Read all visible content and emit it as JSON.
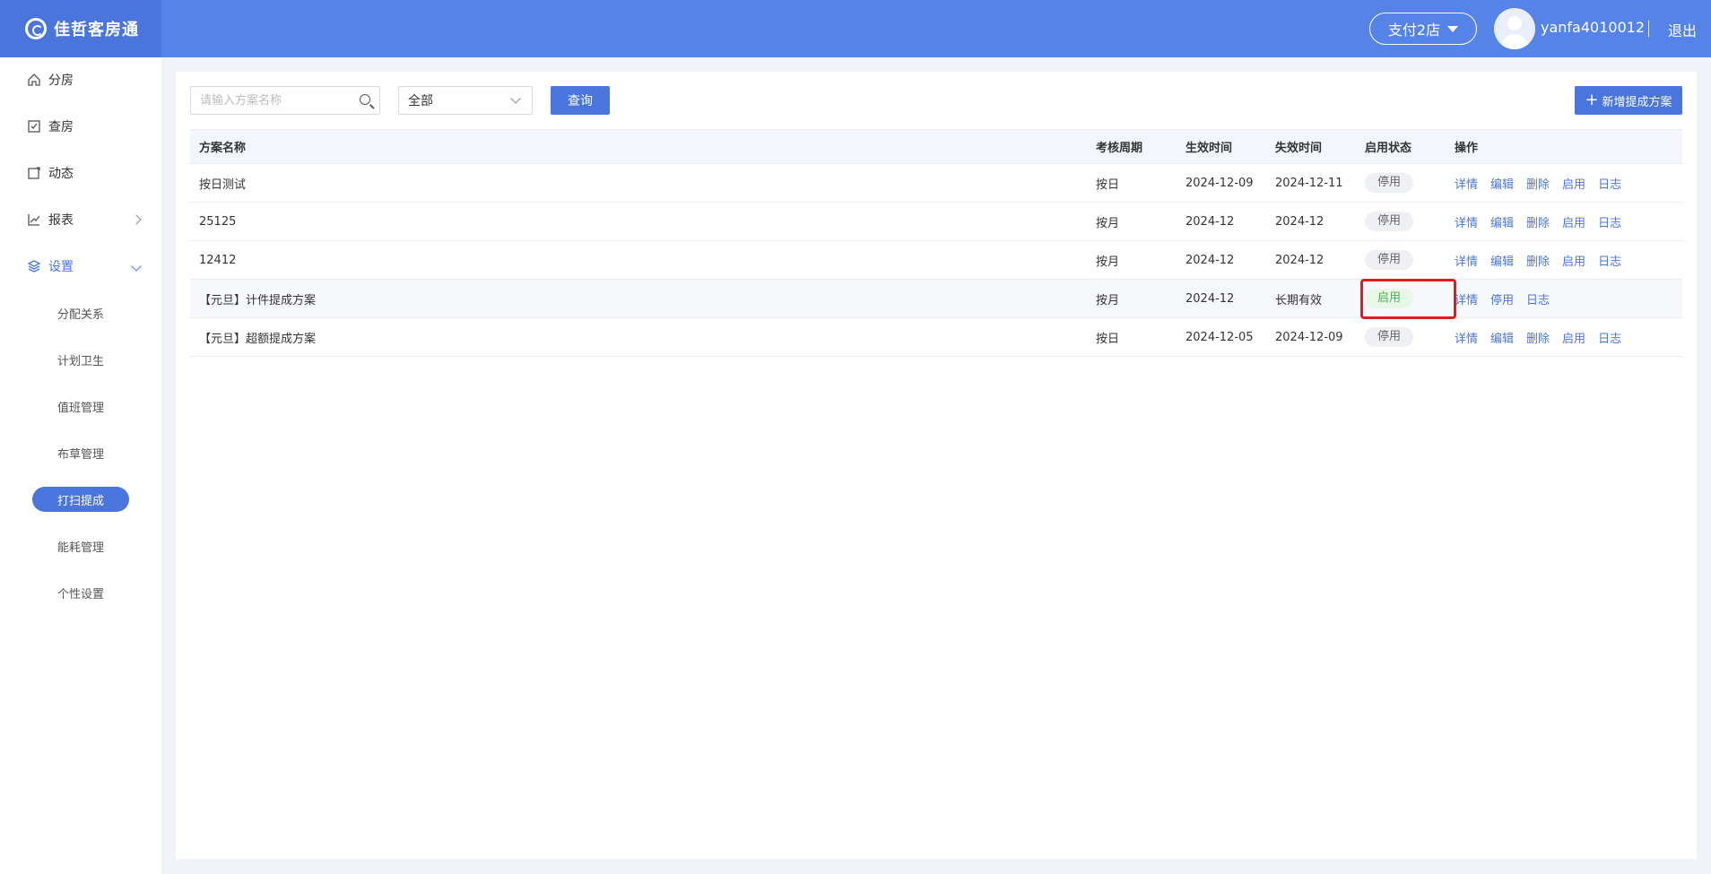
{
  "header": {
    "brand": "佳哲客房通",
    "store": "支付2店",
    "username": "yanfa4010012",
    "logout": "退出"
  },
  "sidebar": {
    "items": [
      {
        "label": "分房",
        "icon": "home-icon"
      },
      {
        "label": "查房",
        "icon": "checklist-icon"
      },
      {
        "label": "动态",
        "icon": "dynamic-icon"
      },
      {
        "label": "报表",
        "icon": "chart-icon"
      },
      {
        "label": "设置",
        "icon": "layers-icon"
      }
    ],
    "sub_items": [
      "分配关系",
      "计划卫生",
      "值班管理",
      "布草管理",
      "打扫提成",
      "能耗管理",
      "个性设置"
    ]
  },
  "toolbar": {
    "search_placeholder": "请输入方案名称",
    "filter_value": "全部",
    "query_label": "查询",
    "add_label": "新增提成方案"
  },
  "table": {
    "columns": [
      "方案名称",
      "考核周期",
      "生效时间",
      "失效时间",
      "启用状态",
      "操作"
    ],
    "rows": [
      {
        "name": "按日测试",
        "cycle": "按日",
        "start": "2024-12-09",
        "end": "2024-12-11",
        "status": "停用",
        "actions": [
          "详情",
          "编辑",
          "删除",
          "启用",
          "日志"
        ]
      },
      {
        "name": "25125",
        "cycle": "按月",
        "start": "2024-12",
        "end": "2024-12",
        "status": "停用",
        "actions": [
          "详情",
          "编辑",
          "删除",
          "启用",
          "日志"
        ]
      },
      {
        "name": "12412",
        "cycle": "按月",
        "start": "2024-12",
        "end": "2024-12",
        "status": "停用",
        "actions": [
          "详情",
          "编辑",
          "删除",
          "启用",
          "日志"
        ]
      },
      {
        "name": "【元旦】计件提成方案",
        "cycle": "按月",
        "start": "2024-12",
        "end": "长期有效",
        "status": "启用",
        "actions": [
          "详情",
          "停用",
          "日志"
        ]
      },
      {
        "name": "【元旦】超额提成方案",
        "cycle": "按日",
        "start": "2024-12-05",
        "end": "2024-12-09",
        "status": "停用",
        "actions": [
          "详情",
          "编辑",
          "删除",
          "启用",
          "日志"
        ]
      }
    ]
  },
  "colors": {
    "primary": "#4a75dc",
    "header_bg": "#5683e8",
    "status_on": "#4caf50",
    "highlight": "#e11d1d"
  }
}
